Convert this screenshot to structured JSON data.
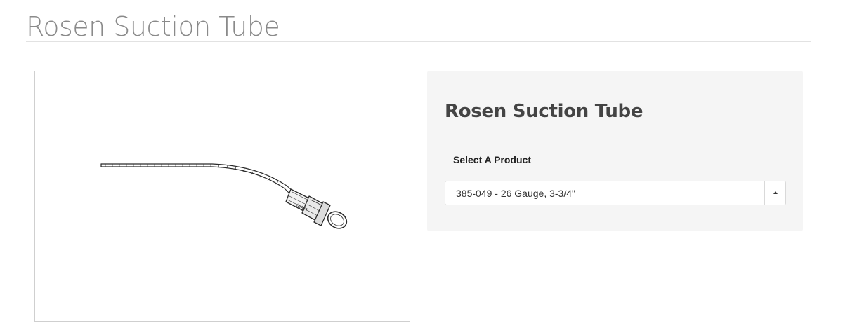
{
  "page": {
    "title": "Rosen Suction Tube"
  },
  "product_image": {
    "icon": "suction-tube-illustration",
    "engraving": "JARIT"
  },
  "panel": {
    "title": "Rosen Suction Tube",
    "select_label": "Select A Product",
    "selected_option": "385-049 - 26 Gauge, 3-3/4\"",
    "dropdown_icon": "caret-up-icon"
  },
  "colors": {
    "page_title": "#8a8a8a",
    "panel_background": "#f5f5f5",
    "panel_title": "#444444"
  }
}
